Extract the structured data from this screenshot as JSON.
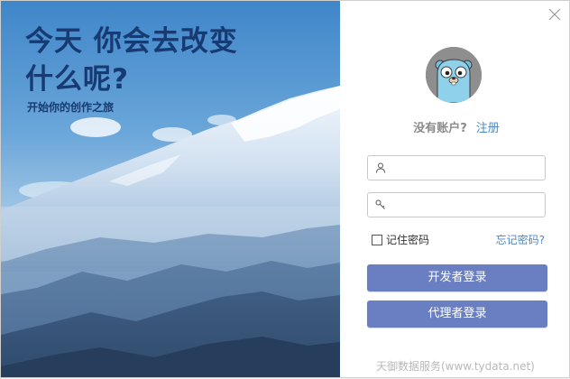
{
  "hero": {
    "title_line1": "今天 你会去改变",
    "title_line2": "什么呢?",
    "subtitle": "开始你的创作之旅"
  },
  "icons": {
    "close": "close-icon",
    "avatar": "gopher-avatar",
    "username": "user-icon",
    "password": "key-icon"
  },
  "signup": {
    "question": "没有账户?",
    "link": "注册"
  },
  "form": {
    "username_value": "",
    "username_placeholder": "",
    "password_value": "",
    "password_placeholder": "",
    "remember_label": "记住密码",
    "remember_checked": false,
    "forgot_label": "忘记密码?"
  },
  "buttons": {
    "developer_login": "开发者登录",
    "agent_login": "代理者登录"
  },
  "footer": {
    "text": "天御数据服务(www.tydata.net)"
  },
  "colors": {
    "title": "#173a73",
    "button": "#6a7fc2",
    "link": "#4b87c9"
  }
}
